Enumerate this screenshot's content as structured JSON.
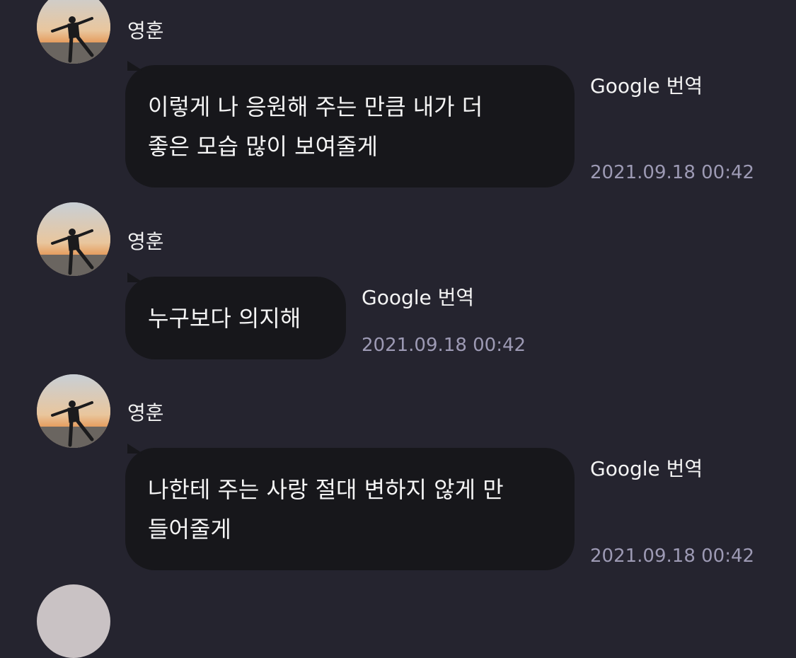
{
  "messages": [
    {
      "sender": "영훈",
      "lines": [
        "이렇게 나 응원해 주는 만큼 내가 더",
        "좋은 모습 많이 보여줄게"
      ],
      "translate_label": "Google 번역",
      "timestamp": "2021.09.18 00:42"
    },
    {
      "sender": "영훈",
      "lines": [
        "누구보다 의지해"
      ],
      "translate_label": "Google 번역",
      "timestamp": "2021.09.18 00:42"
    },
    {
      "sender": "영훈",
      "lines": [
        "나한테 주는 사랑 절대 변하지 않게 만",
        "들어줄게"
      ],
      "translate_label": "Google 번역",
      "timestamp": "2021.09.18 00:42"
    }
  ],
  "colors": {
    "background": "#25242f",
    "bubble": "#17171b",
    "timestamp": "#9d9ab4"
  }
}
